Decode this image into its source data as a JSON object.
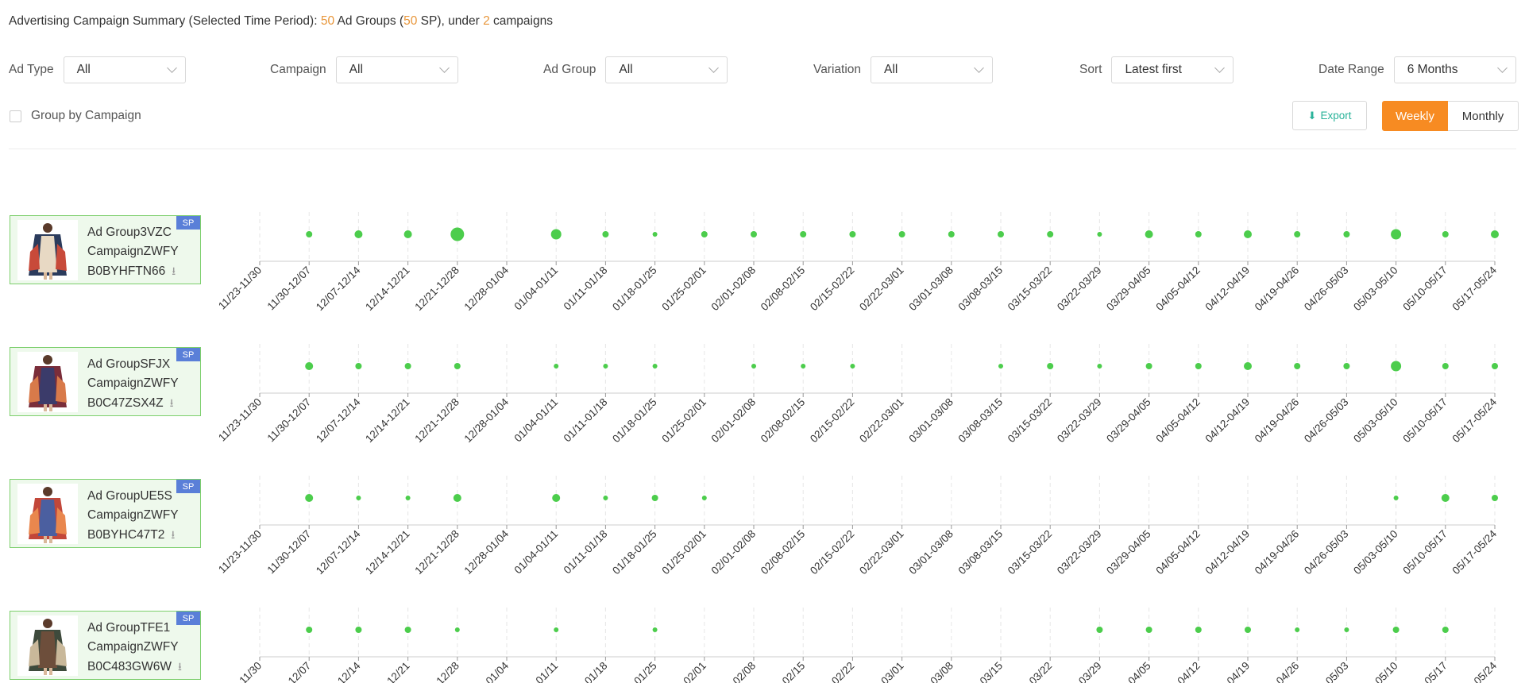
{
  "summary": {
    "prefix": "Advertising Campaign Summary (Selected Time Period): ",
    "ad_groups_count": "50",
    "ad_groups_text": " Ad Groups (",
    "sp_count": "50",
    "sp_text": " SP), under ",
    "campaigns_count": "2",
    "campaigns_text": " campaigns"
  },
  "filters": {
    "ad_type": {
      "label": "Ad Type",
      "value": "All"
    },
    "campaign": {
      "label": "Campaign",
      "value": "All"
    },
    "ad_group": {
      "label": "Ad Group",
      "value": "All"
    },
    "variation": {
      "label": "Variation",
      "value": "All"
    },
    "sort": {
      "label": "Sort",
      "value": "Latest first"
    },
    "date_range": {
      "label": "Date Range",
      "value": "6 Months"
    }
  },
  "group_by_campaign": {
    "label": "Group by Campaign",
    "checked": false
  },
  "export_label": "Export",
  "view_toggle": {
    "weekly": "Weekly",
    "monthly": "Monthly",
    "selected": "Weekly"
  },
  "colors": {
    "accent": "#f78b22",
    "dot": "#4ccd4c",
    "badge": "#5a7fd8",
    "card_border": "#7ccf6c",
    "export": "#2ab39a"
  },
  "weeks": [
    "11/23-11/30",
    "11/30-12/07",
    "12/07-12/14",
    "12/14-12/21",
    "12/21-12/28",
    "12/28-01/04",
    "01/04-01/11",
    "01/11-01/18",
    "01/18-01/25",
    "01/25-02/01",
    "02/01-02/08",
    "02/08-02/15",
    "02/15-02/22",
    "02/22-03/01",
    "03/01-03/08",
    "03/08-03/15",
    "03/15-03/22",
    "03/22-03/29",
    "03/29-04/05",
    "04/05-04/12",
    "04/12-04/19",
    "04/19-04/26",
    "04/26-05/03",
    "05/03-05/10",
    "05/10-05/17",
    "05/17-05/24"
  ],
  "chart_data": {
    "type": "scatter",
    "x": [
      "11/23-11/30",
      "11/30-12/07",
      "12/07-12/14",
      "12/14-12/21",
      "12/21-12/28",
      "12/28-01/04",
      "01/04-01/11",
      "01/11-01/18",
      "01/18-01/25",
      "01/25-02/01",
      "02/01-02/08",
      "02/08-02/15",
      "02/15-02/22",
      "02/22-03/01",
      "03/01-03/08",
      "03/08-03/15",
      "03/15-03/22",
      "03/22-03/29",
      "03/29-04/05",
      "04/05-04/12",
      "04/12-04/19",
      "04/19-04/26",
      "04/26-05/03",
      "05/03-05/10",
      "05/10-05/17",
      "05/17-05/24"
    ],
    "note": "dot size by relative level (0 = no dot)",
    "series": [
      {
        "values": [
          0,
          2,
          3,
          3,
          6,
          0,
          4,
          2,
          1,
          2,
          2,
          2,
          2,
          2,
          2,
          2,
          2,
          1,
          3,
          2,
          3,
          2,
          2,
          4,
          2,
          3
        ]
      },
      {
        "values": [
          0,
          3,
          2,
          2,
          2,
          0,
          1,
          1,
          1,
          0,
          1,
          1,
          1,
          0,
          0,
          1,
          2,
          1,
          2,
          2,
          3,
          2,
          2,
          4,
          2,
          2
        ]
      },
      {
        "values": [
          0,
          3,
          1,
          1,
          3,
          0,
          3,
          1,
          2,
          1,
          0,
          0,
          0,
          0,
          0,
          0,
          0,
          0,
          0,
          0,
          0,
          0,
          0,
          1,
          3,
          2
        ]
      },
      {
        "values": [
          0,
          2,
          2,
          2,
          1,
          0,
          1,
          0,
          1,
          0,
          0,
          0,
          0,
          0,
          0,
          0,
          0,
          2,
          2,
          2,
          2,
          1,
          1,
          2,
          2,
          0
        ]
      }
    ]
  },
  "rows": [
    {
      "ad_group": "Ad Group3VZC",
      "campaign": "CampaignZWFY",
      "asin": "B0BYHFTN66",
      "badge": "SP",
      "colors": [
        "#2b3b5c",
        "#c84a3a",
        "#e8d9c4"
      ]
    },
    {
      "ad_group": "Ad GroupSFJX",
      "campaign": "CampaignZWFY",
      "asin": "B0C47ZSX4Z",
      "badge": "SP",
      "colors": [
        "#7a2d3a",
        "#d87a4a",
        "#3b3b6a"
      ]
    },
    {
      "ad_group": "Ad GroupUE5S",
      "campaign": "CampaignZWFY",
      "asin": "B0BYHC47T2",
      "badge": "SP",
      "colors": [
        "#c2473a",
        "#e9874e",
        "#4b5fa0"
      ]
    },
    {
      "ad_group": "Ad GroupTFE1",
      "campaign": "CampaignZWFY",
      "asin": "B0C483GW6W",
      "badge": "SP",
      "colors": [
        "#3e4a3c",
        "#c9b89a",
        "#6d4e3b"
      ]
    }
  ]
}
